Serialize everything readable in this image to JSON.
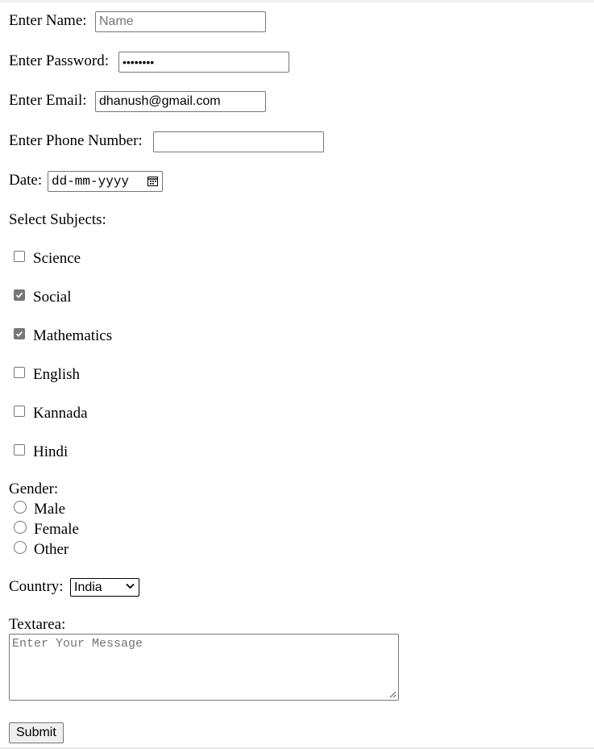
{
  "form": {
    "name": {
      "label": "Enter Name:",
      "value": "",
      "placeholder": "Name"
    },
    "password": {
      "label": "Enter Password:",
      "value": "••••••••"
    },
    "email": {
      "label": "Enter Email:",
      "value": "dhanush@gmail.com"
    },
    "phone": {
      "label": "Enter Phone Number:",
      "value": ""
    },
    "date": {
      "label": "Date:",
      "placeholder": "dd-mm-yyyy",
      "icon": "calendar-icon"
    },
    "subjects": {
      "label": "Select Subjects:",
      "items": [
        {
          "label": "Science",
          "checked": false
        },
        {
          "label": "Social",
          "checked": true
        },
        {
          "label": "Mathematics",
          "checked": true
        },
        {
          "label": "English",
          "checked": false
        },
        {
          "label": "Kannada",
          "checked": false
        },
        {
          "label": "Hindi",
          "checked": false
        }
      ]
    },
    "gender": {
      "label": "Gender:",
      "options": [
        {
          "label": "Male",
          "selected": false
        },
        {
          "label": "Female",
          "selected": false
        },
        {
          "label": "Other",
          "selected": false
        }
      ]
    },
    "country": {
      "label": "Country:",
      "selected": "India",
      "icon": "chevron-down-icon"
    },
    "message": {
      "label": "Textarea:",
      "placeholder": "Enter Your Message",
      "value": ""
    },
    "submit_label": "Submit"
  },
  "colors": {
    "border": "#767676",
    "checked_fill": "#767676",
    "placeholder": "#757575",
    "button_bg": "#efefef"
  }
}
